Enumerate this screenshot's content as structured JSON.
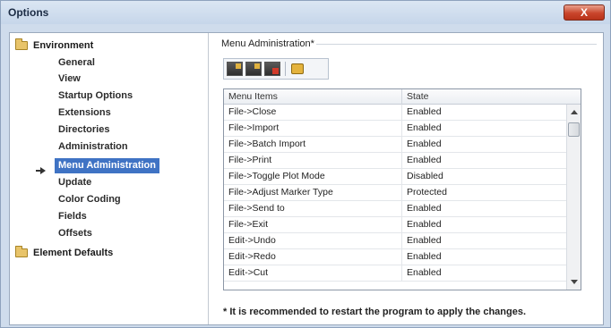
{
  "window": {
    "title": "Options",
    "close_label": "X",
    "accent_color": "#3f73c4"
  },
  "tree": {
    "environment_label": "Environment",
    "items": [
      {
        "label": "General"
      },
      {
        "label": "View"
      },
      {
        "label": "Startup Options"
      },
      {
        "label": "Extensions"
      },
      {
        "label": "Directories"
      },
      {
        "label": "Administration"
      },
      {
        "label": "Menu Administration",
        "selected": true
      },
      {
        "label": "Update"
      },
      {
        "label": "Color Coding"
      },
      {
        "label": "Fields"
      },
      {
        "label": "Offsets"
      }
    ],
    "element_defaults_label": "Element Defaults"
  },
  "panel": {
    "group_label": "Menu Administration*",
    "toolbar_icons": [
      "menu-enable-icon",
      "menu-disable-icon",
      "menu-delete-icon",
      "lock-icon"
    ],
    "columns": [
      "Menu Items",
      "State"
    ],
    "rows": [
      {
        "item": "File->Close",
        "state": "Enabled"
      },
      {
        "item": "File->Import",
        "state": "Enabled"
      },
      {
        "item": "File->Batch Import",
        "state": "Enabled"
      },
      {
        "item": "File->Print",
        "state": "Enabled"
      },
      {
        "item": "File->Toggle Plot Mode",
        "state": "Disabled"
      },
      {
        "item": "File->Adjust Marker Type",
        "state": "Protected"
      },
      {
        "item": "File->Send to",
        "state": "Enabled"
      },
      {
        "item": "File->Exit",
        "state": "Enabled"
      },
      {
        "item": "Edit->Undo",
        "state": "Enabled"
      },
      {
        "item": "Edit->Redo",
        "state": "Enabled"
      },
      {
        "item": "Edit->Cut",
        "state": "Enabled"
      }
    ],
    "note": "* It is recommended to restart the program to apply the changes."
  }
}
